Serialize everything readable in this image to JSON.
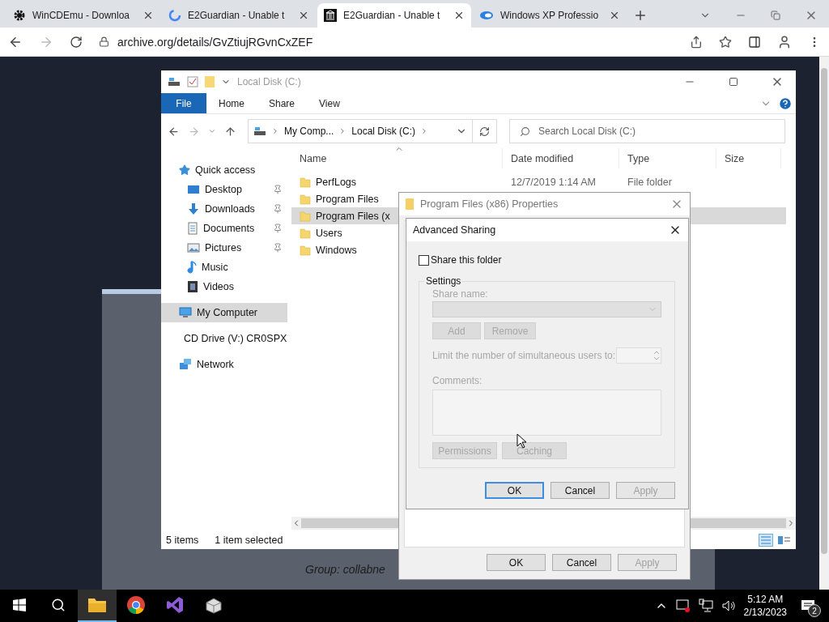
{
  "browser": {
    "tabs": [
      {
        "title": "WinCDEmu - Downloa",
        "selected": false
      },
      {
        "title": "E2Guardian - Unable t",
        "selected": false
      },
      {
        "title": "E2Guardian - Unable t",
        "selected": true
      },
      {
        "title": "Windows XP Professio",
        "selected": false
      }
    ],
    "url": "archive.org/details/GvZtiujRGvnCxZEF"
  },
  "page": {
    "text": "Group: collabne"
  },
  "explorer": {
    "title": "Local Disk (C:)",
    "ribbon": {
      "file": "File",
      "tabs": [
        "Home",
        "Share",
        "View"
      ]
    },
    "breadcrumb": [
      "My Comp...",
      "Local Disk (C:)"
    ],
    "search": {
      "placeholder": "Search Local Disk (C:)"
    },
    "columns": [
      "Name",
      "Date modified",
      "Type",
      "Size"
    ],
    "sidebar": [
      {
        "label": "Quick access",
        "selected": false,
        "children": [
          {
            "label": "Desktop",
            "pinned": true,
            "selected": false
          },
          {
            "label": "Downloads",
            "pinned": true,
            "selected": false
          },
          {
            "label": "Documents",
            "pinned": true,
            "selected": false
          },
          {
            "label": "Pictures",
            "pinned": true,
            "selected": false
          },
          {
            "label": "Music",
            "pinned": false,
            "selected": false
          },
          {
            "label": "Videos",
            "pinned": false,
            "selected": false
          }
        ]
      },
      {
        "label": "My Computer",
        "selected": true
      },
      {
        "label": "CD Drive (V:) CR0SPX",
        "selected": false
      },
      {
        "label": "Network",
        "selected": false
      }
    ],
    "files": [
      {
        "name": "PerfLogs",
        "date_modified": "12/7/2019 1:14 AM",
        "type": "File folder",
        "selected": false
      },
      {
        "name": "Program Files",
        "selected": false
      },
      {
        "name": "Program Files (x",
        "selected": true
      },
      {
        "name": "Users",
        "selected": false
      },
      {
        "name": "Windows",
        "selected": false
      }
    ],
    "status": {
      "count": "5 items",
      "selection": "1 item selected"
    }
  },
  "properties": {
    "title": "Program Files (x86) Properties",
    "buttons": [
      {
        "label": "OK",
        "disabled": false
      },
      {
        "label": "Cancel",
        "disabled": false
      },
      {
        "label": "Apply",
        "disabled": true
      }
    ]
  },
  "advanced_sharing": {
    "title": "Advanced Sharing",
    "share_checkbox": {
      "label": "Share this folder",
      "checked": false
    },
    "settings": {
      "title": "Settings",
      "disabled": true,
      "share_name_label": "Share name:",
      "add": "Add",
      "remove": "Remove",
      "limit_label": "Limit the number of simultaneous users to:",
      "comments_label": "Comments:",
      "permissions": "Permissions",
      "caching": "Caching"
    },
    "buttons": [
      {
        "label": "OK",
        "default": true,
        "disabled": false
      },
      {
        "label": "Cancel",
        "default": false,
        "disabled": false
      },
      {
        "label": "Apply",
        "default": false,
        "disabled": true
      }
    ]
  },
  "taskbar": {
    "apps": [
      {
        "selected": true
      },
      {
        "selected": false
      },
      {
        "selected": false
      },
      {
        "selected": false
      }
    ],
    "time": "5:12 AM",
    "date": "2/13/2023",
    "notifications": "2"
  }
}
